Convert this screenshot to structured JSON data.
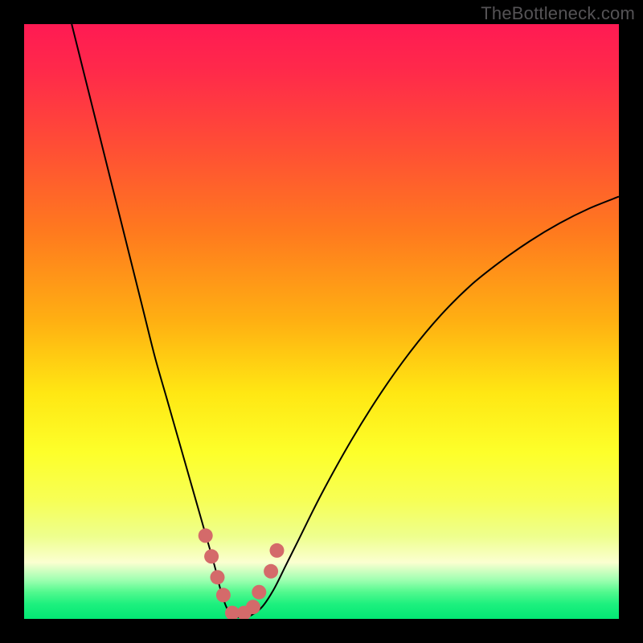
{
  "watermark": {
    "text": "TheBottleneck.com"
  },
  "colors": {
    "bg": "#000000",
    "gradient_stops": [
      {
        "offset": 0.0,
        "color": "#ff1a53"
      },
      {
        "offset": 0.08,
        "color": "#ff2a4a"
      },
      {
        "offset": 0.2,
        "color": "#ff4c36"
      },
      {
        "offset": 0.35,
        "color": "#ff7a1e"
      },
      {
        "offset": 0.5,
        "color": "#ffb012"
      },
      {
        "offset": 0.62,
        "color": "#ffe713"
      },
      {
        "offset": 0.72,
        "color": "#fdff2a"
      },
      {
        "offset": 0.8,
        "color": "#f7ff55"
      },
      {
        "offset": 0.86,
        "color": "#eeff8c"
      },
      {
        "offset": 0.905,
        "color": "#fbffd0"
      },
      {
        "offset": 0.935,
        "color": "#9dffb0"
      },
      {
        "offset": 0.955,
        "color": "#52f98e"
      },
      {
        "offset": 0.975,
        "color": "#1df07e"
      },
      {
        "offset": 1.0,
        "color": "#03e874"
      }
    ],
    "curve": "#000000",
    "marker": "#d46a6a"
  },
  "chart_data": {
    "type": "line",
    "title": "",
    "xlabel": "",
    "ylabel": "",
    "xlim": [
      0,
      100
    ],
    "ylim": [
      0,
      100
    ],
    "series": [
      {
        "name": "bottleneck-curve",
        "x": [
          8,
          10,
          12,
          14,
          16,
          18,
          20,
          22,
          24,
          26,
          28,
          30,
          32,
          33,
          34,
          35,
          36,
          37,
          38,
          40,
          42,
          44,
          46,
          50,
          55,
          60,
          65,
          70,
          75,
          80,
          85,
          90,
          95,
          100
        ],
        "y": [
          100,
          92,
          84,
          76,
          68,
          60,
          52,
          44,
          37,
          30,
          23,
          16,
          9,
          5,
          2,
          0.5,
          0.3,
          0.3,
          0.5,
          2,
          5,
          9,
          13,
          21,
          30,
          38,
          45,
          51,
          56,
          60,
          63.5,
          66.5,
          69,
          71
        ]
      }
    ],
    "markers": {
      "name": "highlight-dots",
      "x": [
        30.5,
        31.5,
        32.5,
        33.5,
        35,
        37,
        38.5,
        39.5,
        41.5,
        42.5
      ],
      "y": [
        14,
        10.5,
        7,
        4,
        1,
        1,
        2,
        4.5,
        8,
        11.5
      ]
    }
  }
}
